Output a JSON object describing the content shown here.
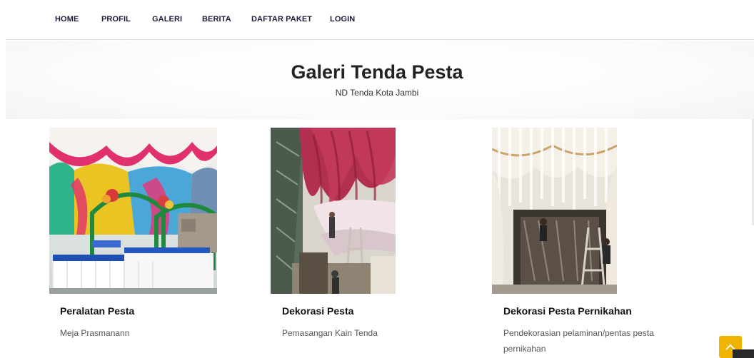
{
  "nav": {
    "items": [
      {
        "label": "HOME"
      },
      {
        "label": "PROFIL"
      },
      {
        "label": "GALERI"
      },
      {
        "label": "BERITA"
      },
      {
        "label": "DAFTAR PAKET"
      },
      {
        "label": "LOGIN"
      }
    ]
  },
  "header": {
    "title": "Galeri Tenda Pesta",
    "subtitle": "ND Tenda Kota Jambi"
  },
  "gallery": {
    "items": [
      {
        "title": "Peralatan Pesta",
        "description": "Meja Prasmanann"
      },
      {
        "title": "Dekorasi Pesta",
        "description": "Pemasangan Kain Tenda"
      },
      {
        "title": "Dekorasi Pesta Pernikahan",
        "description": "Pendekorasian pelaminan/pentas pesta pernikahan"
      }
    ]
  },
  "icons": {
    "scroll_top": "chevron-up-icon"
  },
  "colors": {
    "accent": "#f0b400",
    "nav_text": "#1c1c3a"
  }
}
